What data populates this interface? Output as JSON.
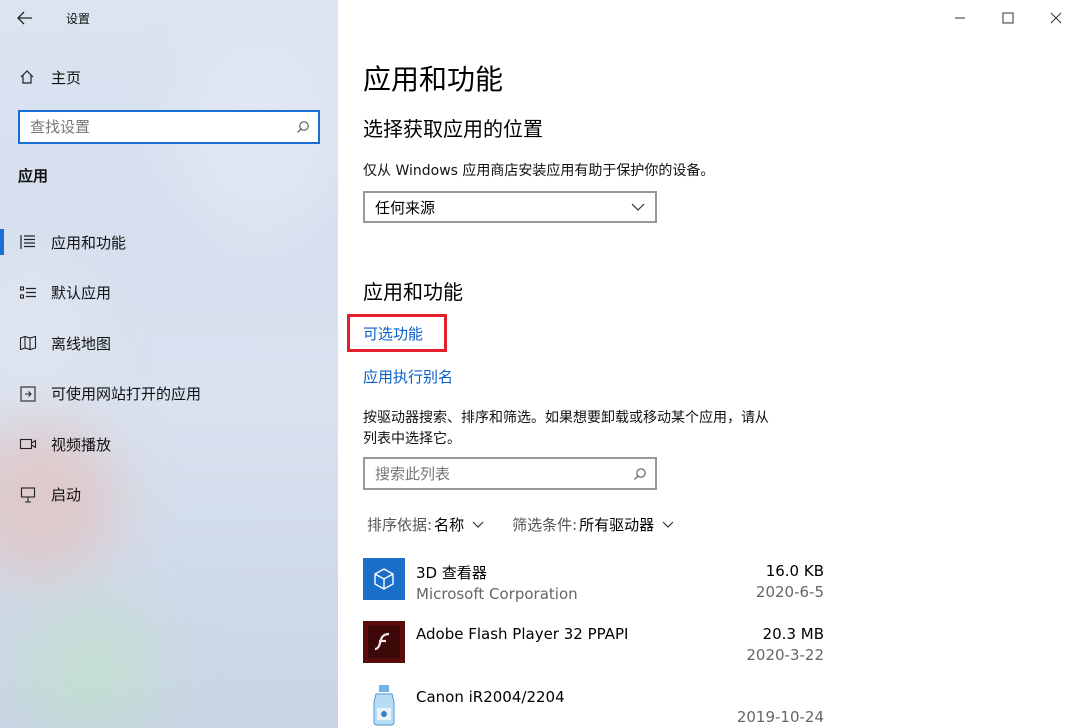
{
  "window": {
    "title": "设置"
  },
  "sidebar": {
    "home_label": "主页",
    "search_placeholder": "查找设置",
    "section_title": "应用",
    "items": [
      {
        "label": "应用和功能",
        "icon": "list-detail-icon",
        "active": true
      },
      {
        "label": "默认应用",
        "icon": "default-apps-icon",
        "active": false
      },
      {
        "label": "离线地图",
        "icon": "map-icon",
        "active": false
      },
      {
        "label": "可使用网站打开的应用",
        "icon": "website-app-icon",
        "active": false
      },
      {
        "label": "视频播放",
        "icon": "video-icon",
        "active": false
      },
      {
        "label": "启动",
        "icon": "startup-icon",
        "active": false
      }
    ]
  },
  "main": {
    "page_title": "应用和功能",
    "install_section": {
      "title": "选择获取应用的位置",
      "description": "仅从 Windows 应用商店安装应用有助于保护你的设备。",
      "dropdown_value": "任何来源"
    },
    "apps_section": {
      "title": "应用和功能",
      "optional_features_link": "可选功能",
      "aliases_link": "应用执行别名",
      "description_line1": "按驱动器搜索、排序和筛选。如果想要卸载或移动某个应用，请从",
      "description_line2": "列表中选择它。",
      "search_placeholder": "搜索此列表",
      "sort_label": "排序依据:",
      "sort_value": "名称",
      "filter_label": "筛选条件:",
      "filter_value": "所有驱动器"
    },
    "apps": [
      {
        "name": "3D 查看器",
        "publisher": "Microsoft Corporation",
        "size": "16.0 KB",
        "date": "2020-6-5",
        "icon": "3d-viewer-icon"
      },
      {
        "name": "Adobe Flash Player 32 PPAPI",
        "publisher": "",
        "size": "20.3 MB",
        "date": "2020-3-22",
        "icon": "flash-player-icon"
      },
      {
        "name": "Canon iR2004/2204",
        "publisher": "",
        "size": "",
        "date": "2019-10-24",
        "icon": "printer-driver-icon"
      }
    ]
  },
  "colors": {
    "accent": "#1a6fd6",
    "link": "#0a5fc7",
    "highlight": "#e3202a"
  }
}
